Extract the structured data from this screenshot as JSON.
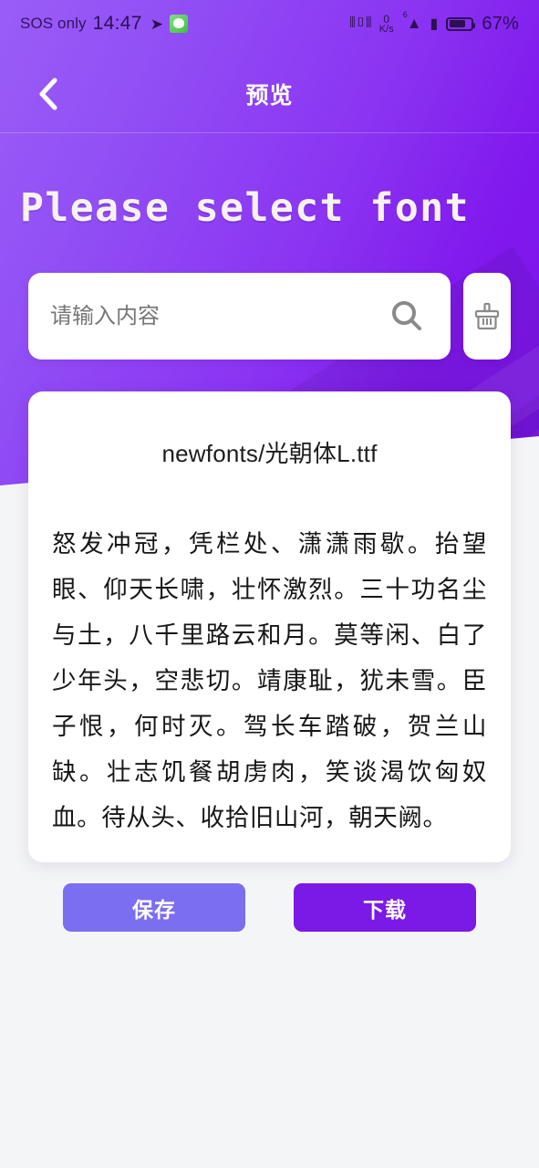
{
  "status_bar": {
    "carrier": "SOS only",
    "time": "14:47",
    "telegram_icon": "telegram-icon",
    "wechat_icon": "wechat-icon",
    "vibrate_icon": "vibrate-icon",
    "net_speed_value": "0",
    "net_speed_unit": "K/s",
    "wifi_icon": "wifi-icon",
    "wifi_generation": "6",
    "sim_icon": "sim-alert-icon",
    "battery_percent": "67%",
    "battery_level": 67
  },
  "nav": {
    "back_icon": "chevron-left-icon",
    "title": "预览"
  },
  "hero": {
    "heading": "Please select font",
    "gradient_from": "#9a5df7",
    "gradient_to": "#7d14ec"
  },
  "search": {
    "value": "",
    "placeholder": "请输入内容",
    "search_icon": "search-icon",
    "clear_icon": "broom-icon"
  },
  "preview_card": {
    "font_path": "newfonts/光朝体L.ttf",
    "sample_text": "怒发冲冠，凭栏处、潇潇雨歇。抬望眼、仰天长啸，壮怀激烈。三十功名尘与土，八千里路云和月。莫等闲、白了少年头，空悲切。靖康耻，犹未雪。臣子恨，何时灭。驾长车踏破，贺兰山缺。壮志饥餐胡虏肉，笑谈渴饮匈奴血。待从头、收拾旧山河，朝天阙。",
    "save_label": "保存",
    "download_label": "下载",
    "save_color": "#7b6ef0",
    "download_color": "#7b19e6"
  },
  "page_background": "#f4f5f7"
}
